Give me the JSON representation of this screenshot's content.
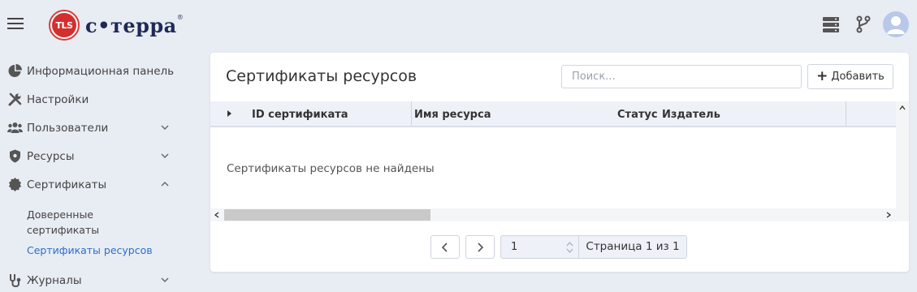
{
  "header": {
    "logo_badge": "TLS",
    "logo_text": "с•терра",
    "logo_reg": "®",
    "icons": [
      "menu-icon",
      "server-icon",
      "git-branch-icon",
      "user-avatar-icon"
    ]
  },
  "sidebar": {
    "items": [
      {
        "label": "Информационная панель",
        "icon": "dashboard-pie-icon"
      },
      {
        "label": "Настройки",
        "icon": "wrench-screwdriver-icon"
      },
      {
        "label": "Пользователи",
        "icon": "users-icon",
        "chevron": "down"
      },
      {
        "label": "Ресурсы",
        "icon": "shield-icon",
        "chevron": "down"
      },
      {
        "label": "Сертификаты",
        "icon": "certificate-badge-icon",
        "chevron": "up"
      }
    ],
    "sub_items": [
      {
        "label": "Доверенные сертификаты",
        "active": false
      },
      {
        "label": "Сертификаты ресурсов",
        "active": true
      }
    ],
    "last_item": {
      "label": "Журналы",
      "icon": "stethoscope-icon",
      "chevron": "down"
    }
  },
  "main": {
    "title": "Сертификаты ресурсов",
    "search_placeholder": "Поиск...",
    "add_label": "Добавить",
    "columns": [
      "ID сертификата",
      "Имя ресурса",
      "Статус",
      "Издатель"
    ],
    "empty_message": "Сертификаты ресурсов не найдены",
    "pagination": {
      "page_value": "1",
      "page_label": "Страница 1 из 1"
    }
  },
  "colors": {
    "background": "#e8ecf3",
    "accent_link": "#2c6fc9",
    "logo_red": "#d32f2f",
    "logo_navy": "#1e2a55"
  }
}
